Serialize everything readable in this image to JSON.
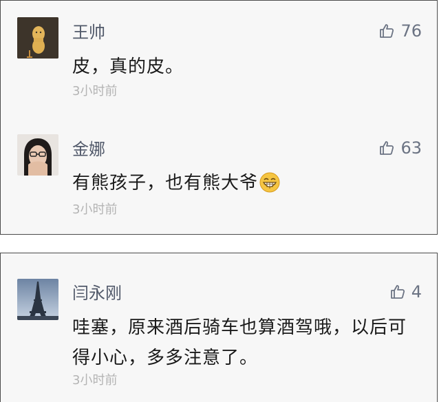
{
  "comments_panel_1": [
    {
      "author": "王帅",
      "likes": "76",
      "content": "皮，真的皮。",
      "time": "3小时前",
      "avatar_icon": "peanut-avatar-icon"
    },
    {
      "author": "金娜",
      "likes": "63",
      "content": "有熊孩子，也有熊大爷",
      "time": "3小时前",
      "avatar_icon": "girl-glasses-avatar-icon",
      "emoji_icon": "grinning-face-emoji-icon"
    }
  ],
  "comments_panel_2": [
    {
      "author": "闫永刚",
      "likes": "4",
      "content": "哇塞，原来酒后骑车也算酒驾哦，以后可得小心，多多注意了。",
      "time": "3小时前",
      "avatar_icon": "eiffel-tower-avatar-icon"
    }
  ],
  "colors": {
    "author": "#51596a",
    "content": "#1a1a1a",
    "time": "#b4b4b4",
    "like": "#6b7383",
    "panel_bg": "#f7f7f7",
    "border": "#4a4a4a"
  }
}
